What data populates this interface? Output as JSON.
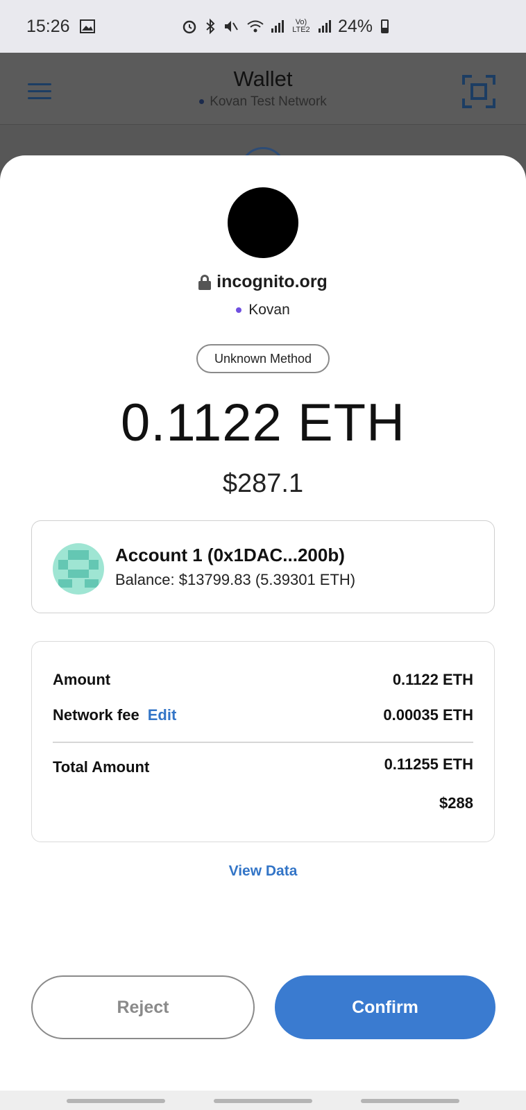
{
  "status_bar": {
    "time": "15:26",
    "lte_label": "Vo) LTE2",
    "battery": "24%",
    "icons": [
      "image-icon",
      "alarm-icon",
      "bluetooth-icon",
      "mute-icon",
      "wifi-icon",
      "signal-icon",
      "battery-icon"
    ]
  },
  "app_header": {
    "title": "Wallet",
    "network": "Kovan Test Network"
  },
  "request": {
    "site": "incognito.org",
    "network": "Kovan",
    "method": "Unknown Method",
    "amount_eth": "0.1122 ETH",
    "amount_usd": "$287.1"
  },
  "account": {
    "name": "Account 1 (0x1DAC...200b)",
    "balance": "Balance: $13799.83 (5.39301 ETH)"
  },
  "summary": {
    "amount_label": "Amount",
    "amount_value": "0.1122 ETH",
    "fee_label": "Network fee",
    "fee_edit": "Edit",
    "fee_value": "0.00035 ETH",
    "total_label": "Total Amount",
    "total_eth": "0.11255 ETH",
    "total_usd": "$288"
  },
  "view_data": "View Data",
  "actions": {
    "reject": "Reject",
    "confirm": "Confirm"
  },
  "colors": {
    "accent": "#3a7bd0",
    "network_dot": "#6f4fe0"
  }
}
